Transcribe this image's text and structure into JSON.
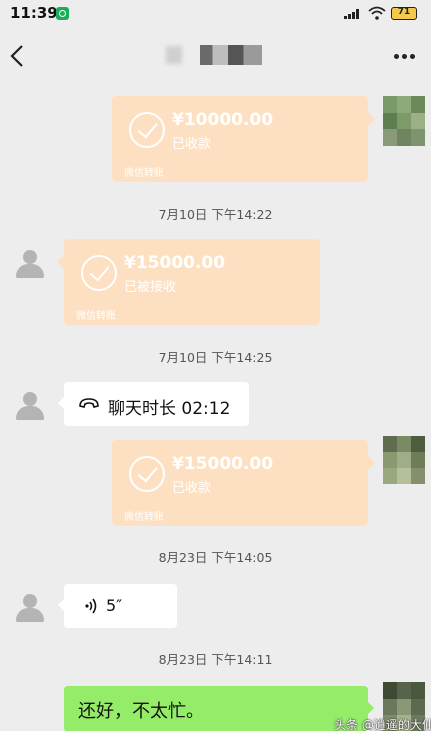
{
  "status_bar": {
    "time": "11:39",
    "battery": "71"
  },
  "nav": {
    "title": "张"
  },
  "messages": {
    "m1": {
      "amount": "¥10000.00",
      "status": "已收款",
      "footer": "微信转账"
    },
    "t1": "7月10日 下午14:22",
    "m2": {
      "amount": "¥15000.00",
      "status": "已被接收",
      "footer": "微信转账"
    },
    "t2": "7月10日 下午14:25",
    "m3": {
      "text": "聊天时长 02:12"
    },
    "m4": {
      "amount": "¥15000.00",
      "status": "已收款",
      "footer": "微信转账"
    },
    "t3": "8月23日 下午14:05",
    "m5": {
      "duration": "5″"
    },
    "t4": "8月23日 下午14:11",
    "m6": {
      "text": "还好，不太忙。"
    }
  },
  "watermark": "头条 @逍遥的大仙",
  "colors": {
    "transfer": "#fde0c2",
    "green_bubble": "#95ec69",
    "background": "#ededed"
  }
}
